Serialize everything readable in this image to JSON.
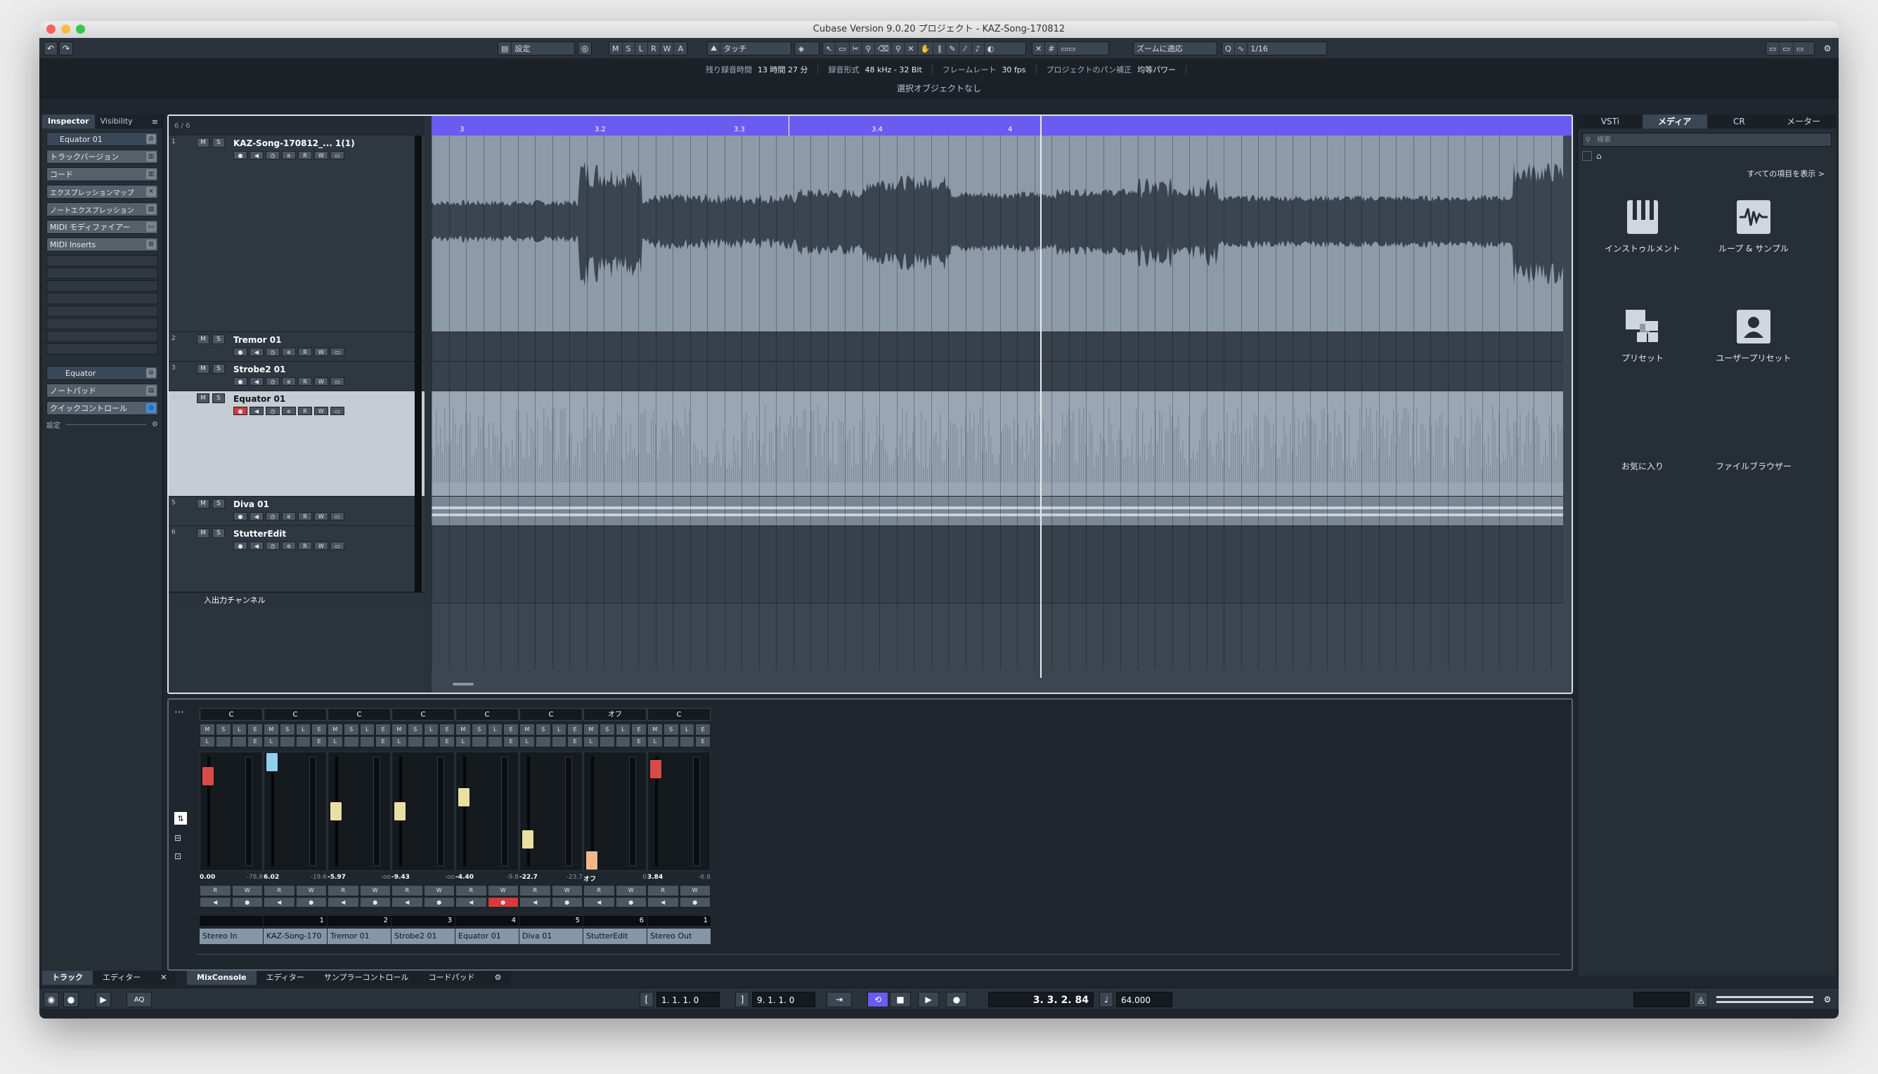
{
  "window": {
    "title": "Cubase Version 9.0.20 プロジェクト - KAZ-Song-170812"
  },
  "toolbar": {
    "preset_label": "設定",
    "modes": [
      "M",
      "S",
      "L",
      "R",
      "W",
      "A"
    ],
    "automation_mode": "タッチ",
    "zoom_label": "ズームに適応",
    "quantize": "1/16"
  },
  "infobar": {
    "rec_time_label": "残り録音時間",
    "rec_time_value": "13 時間 27 分",
    "format_label": "録音形式",
    "format_value": "48 kHz - 32 Bit",
    "framerate_label": "フレームレート",
    "framerate_value": "30 fps",
    "pan_label": "プロジェクトのパン補正",
    "pan_value": "均等パワー",
    "selection": "選択オブジェクトなし"
  },
  "inspector": {
    "tabs": [
      "Inspector",
      "Visibility"
    ],
    "track_name": "Equator 01",
    "rows": [
      "トラックバージョン",
      "コード",
      "エクスプレッションマップ",
      "ノートエクスプレッション",
      "MIDI モディファイアー",
      "MIDI Inserts"
    ],
    "instrument": "Equator",
    "rows2": [
      "ノートパッド",
      "クイックコントロール"
    ],
    "settings": "設定"
  },
  "tracklist": {
    "count": "6 / 6",
    "tracks": [
      {
        "num": "1",
        "name": "KAZ-Song-170812_... 1(1)"
      },
      {
        "num": "2",
        "name": "Tremor 01"
      },
      {
        "num": "3",
        "name": "Strobe2 01"
      },
      {
        "num": "4",
        "name": "Equator 01"
      },
      {
        "num": "5",
        "name": "Diva 01"
      },
      {
        "num": "6",
        "name": "StutterEdit"
      }
    ],
    "io_channel": "入出力チャンネル"
  },
  "ruler": {
    "marks": [
      "3",
      "3.2",
      "3.3",
      "3.4",
      "4"
    ]
  },
  "mixer": {
    "strips": [
      {
        "pan": "C",
        "val": "0.00",
        "peak": "-78.8",
        "num": "",
        "name": "Stereo In",
        "color": "#d84b4b"
      },
      {
        "pan": "C",
        "val": "6.02",
        "peak": "-19.6",
        "num": "1",
        "name": "KAZ-Song-170",
        "color": "#8fd0ef"
      },
      {
        "pan": "C",
        "val": "-5.97",
        "peak": "-oo",
        "num": "2",
        "name": "Tremor 01",
        "color": "#e8e0a0"
      },
      {
        "pan": "C",
        "val": "-9.43",
        "peak": "-oo",
        "num": "3",
        "name": "Strobe2 01",
        "color": "#e8e0a0"
      },
      {
        "pan": "C",
        "val": "-4.40",
        "peak": "-9.8",
        "num": "4",
        "name": "Equator 01",
        "color": "#e8e0a0"
      },
      {
        "pan": "C",
        "val": "-22.7",
        "peak": "-23.7",
        "num": "5",
        "name": "Diva 01",
        "color": "#e8e0a0"
      },
      {
        "pan": "オフ",
        "val": "オフ",
        "peak": "0",
        "num": "6",
        "name": "StutterEdit",
        "color": "#f0b88a"
      },
      {
        "pan": "C",
        "val": "3.84",
        "peak": "-6.8",
        "num": "1",
        "name": "Stereo Out",
        "color": "#d84b4b"
      }
    ]
  },
  "rightzone": {
    "tabs": [
      "VSTi",
      "メディア",
      "CR",
      "メーター"
    ],
    "search_placeholder": "検索",
    "show_all": "すべての項目を表示 >",
    "tiles": [
      "インストゥルメント",
      "ループ & サンプル",
      "プリセット",
      "ユーザープリセット",
      "お気に入り",
      "ファイルブラウザー"
    ]
  },
  "bottom": {
    "left_tabs": [
      "トラック",
      "エディター"
    ],
    "lower_tabs": [
      "MixConsole",
      "エディター",
      "サンプラーコントロール",
      "コードパッド"
    ]
  },
  "transport": {
    "left_locator": "1. 1. 1. 0",
    "right_locator": "9. 1. 1. 0",
    "position": "3. 3. 2. 84",
    "tempo": "64.000"
  }
}
